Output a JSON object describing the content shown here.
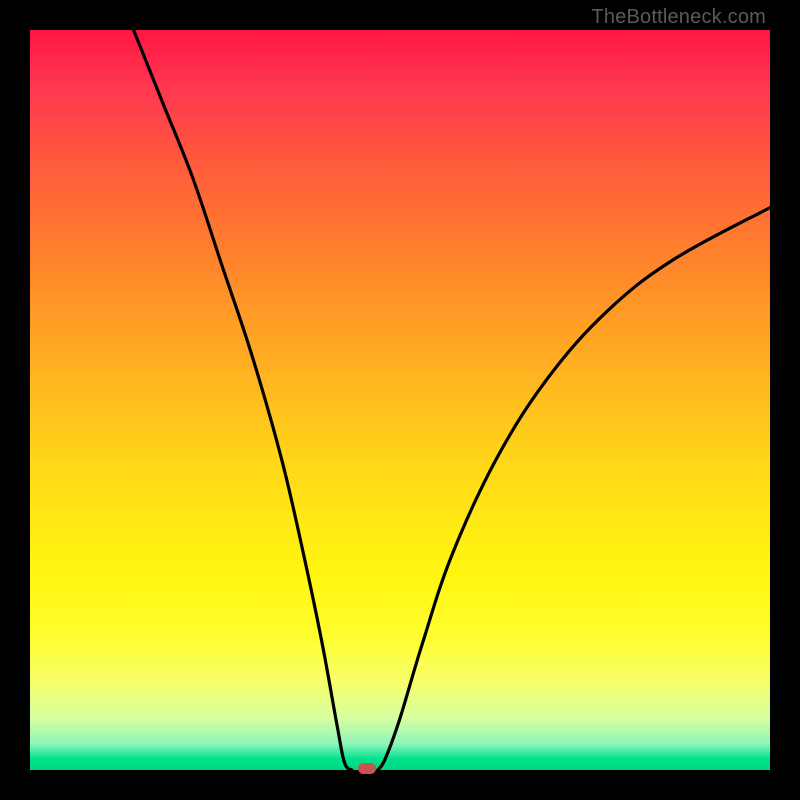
{
  "watermark": "TheBottleneck.com",
  "colors": {
    "frame": "#000000",
    "curve": "#000000",
    "marker": "#c7544e"
  },
  "chart_data": {
    "type": "line",
    "title": "",
    "xlabel": "",
    "ylabel": "",
    "xlim": [
      0,
      100
    ],
    "ylim": [
      0,
      100
    ],
    "grid": false,
    "legend": false,
    "left_branch": [
      {
        "x": 14,
        "y": 100
      },
      {
        "x": 18,
        "y": 90
      },
      {
        "x": 22,
        "y": 80
      },
      {
        "x": 26,
        "y": 68
      },
      {
        "x": 30,
        "y": 56
      },
      {
        "x": 34,
        "y": 42
      },
      {
        "x": 37,
        "y": 29
      },
      {
        "x": 39.5,
        "y": 17
      },
      {
        "x": 41.5,
        "y": 6
      },
      {
        "x": 42.5,
        "y": 1
      },
      {
        "x": 43.5,
        "y": 0
      }
    ],
    "right_branch": [
      {
        "x": 47,
        "y": 0
      },
      {
        "x": 48,
        "y": 1.5
      },
      {
        "x": 50,
        "y": 7
      },
      {
        "x": 53,
        "y": 17
      },
      {
        "x": 57,
        "y": 29
      },
      {
        "x": 63,
        "y": 42
      },
      {
        "x": 70,
        "y": 53
      },
      {
        "x": 78,
        "y": 62
      },
      {
        "x": 87,
        "y": 69
      },
      {
        "x": 100,
        "y": 76
      }
    ],
    "marker": {
      "x": 45.5,
      "y": 0.3
    },
    "gradient_stops": [
      {
        "pos": 0,
        "color": "#ff1744"
      },
      {
        "pos": 50,
        "color": "#ffcc00"
      },
      {
        "pos": 88,
        "color": "#ffff55"
      },
      {
        "pos": 100,
        "color": "#00d880"
      }
    ]
  }
}
